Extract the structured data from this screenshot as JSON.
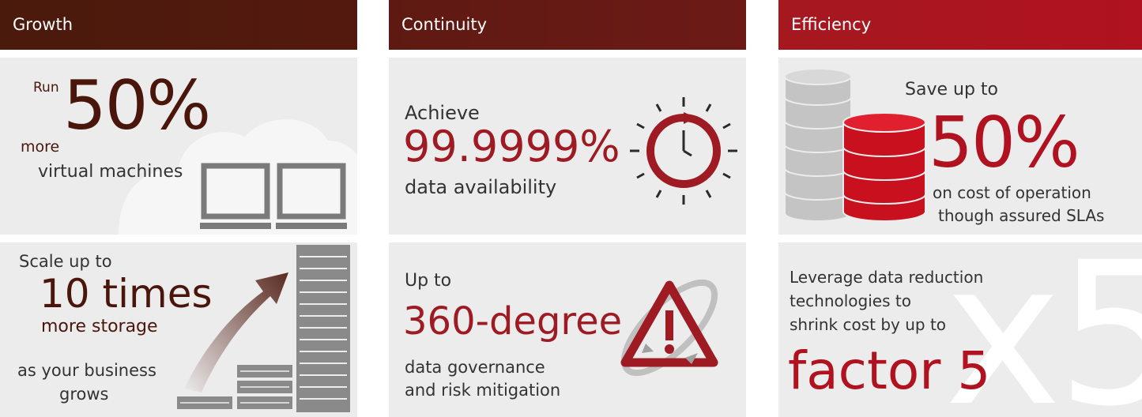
{
  "growth": {
    "title": "Growth",
    "top": {
      "prefix": "Run",
      "value": "50%",
      "line1": "more",
      "line2": "virtual machines"
    },
    "bottom": {
      "line1": "Scale up to",
      "value": "10 times",
      "line2": "more storage",
      "line3": "as your business",
      "line4": "grows"
    }
  },
  "continuity": {
    "title": "Continuity",
    "top": {
      "line1": "Achieve",
      "value": "99.9999%",
      "line2": "data availability"
    },
    "bottom": {
      "line1": "Up to",
      "value": "360-degree",
      "line2": "data governance",
      "line3": "and risk mitigation"
    }
  },
  "efficiency": {
    "title": "Efficiency",
    "top": {
      "line1": "Save up to",
      "value": "50%",
      "line2": "on cost of operation",
      "line3": "though assured SLAs"
    },
    "bottom": {
      "line1": "Leverage data reduction",
      "line2": "technologies to",
      "line3": "shrink cost by up to",
      "value": "factor 5",
      "watermark": "x5"
    }
  },
  "colors": {
    "dark_brown": "#4a160c",
    "red": "#9e1b24",
    "bright_red": "#b0121f",
    "panel_grey": "#ececec",
    "icon_grey": "#7a7a7a"
  }
}
